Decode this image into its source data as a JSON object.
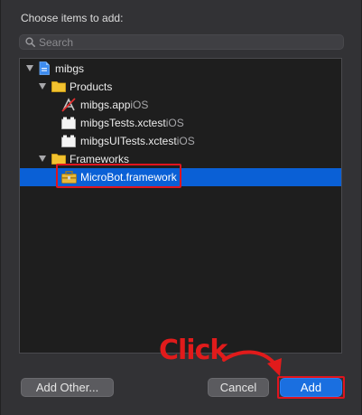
{
  "dialog": {
    "title": "Choose items to add:"
  },
  "search": {
    "placeholder": "Search",
    "value": ""
  },
  "tree": {
    "project": {
      "name": "mibgs"
    },
    "products": {
      "label": "Products",
      "items": [
        {
          "name": "mibgs.app",
          "platform": "iOS"
        },
        {
          "name": "mibgsTests.xctest",
          "platform": "iOS"
        },
        {
          "name": "mibgsUITests.xctest",
          "platform": "iOS"
        }
      ]
    },
    "frameworks": {
      "label": "Frameworks",
      "items": [
        {
          "name": "MicroBot.framework",
          "selected": true
        }
      ]
    }
  },
  "buttons": {
    "add_other": "Add Other...",
    "cancel": "Cancel",
    "add": "Add"
  },
  "annotation": {
    "text": "Click",
    "color": "#e0141e"
  },
  "colors": {
    "selection": "#0a60d6",
    "primary_button": "#1a6fe0",
    "highlight_box": "#e0141e"
  }
}
